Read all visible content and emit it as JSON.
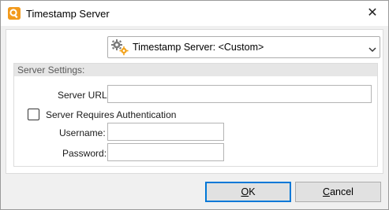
{
  "window": {
    "title": "Timestamp Server",
    "close_glyph": "✕"
  },
  "server_select": {
    "label": "Timestamp Server:",
    "value": "<Custom>",
    "icon": "gears-icon"
  },
  "server_settings": {
    "header": "Server Settings:",
    "url_label": "Server URL:",
    "url_value": "",
    "auth_checkbox_label": "Server Requires Authentication",
    "auth_checked": false,
    "username_label": "Username:",
    "username_value": "",
    "password_label": "Password:",
    "password_value": ""
  },
  "buttons": {
    "ok_access": "O",
    "ok_rest": "K",
    "cancel_access": "C",
    "cancel_rest": "ancel"
  }
}
